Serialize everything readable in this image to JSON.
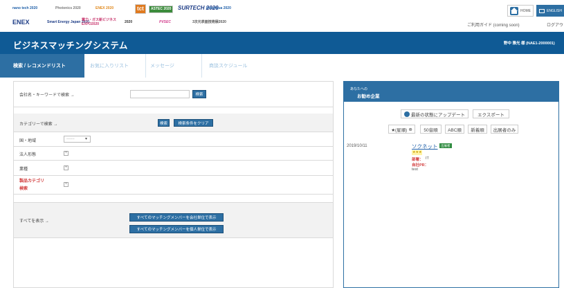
{
  "banner": {
    "logos_row1": [
      "nano tech 2020",
      "Photonics 2020",
      "ENEX 2020",
      "tct",
      "ASTEC 2020",
      "SURTECH 2020",
      "InterAqua 2020"
    ],
    "logos_row2": [
      "ENEX",
      "Smart Energy Japan 2020",
      "電力・ガス新ビジネス EXPO2020",
      "2020",
      "PVSEC",
      "3次元表面技術展2020"
    ],
    "home_label": "HOME",
    "english_label": "ENGLISH",
    "usage_guide": "ご利用ガイド (coming soon)",
    "logout": "ログアウト"
  },
  "header": {
    "title": "ビジネスマッチングシステム",
    "user": "野中 雅光 様 (NAE1-2000001)"
  },
  "tabs": [
    {
      "label": "検索 / レコメンドリスト",
      "active": true
    },
    {
      "label": "お気に入りリスト",
      "active": false
    },
    {
      "label": "メッセージ",
      "active": false
    },
    {
      "label": "商談スケジュール",
      "active": false
    }
  ],
  "search": {
    "keyword_label": "会社名・キーワードで検索 →",
    "keyword_value": "",
    "search_button": "検索",
    "category_label": "カテゴリーで検索 →",
    "category_search_button": "検索",
    "clear_button": "検索条件をクリア",
    "country_label": "国・地域",
    "country_select": "-------",
    "corporate_label": "法人形態",
    "industry_label": "業種",
    "product_label_line1": "製品カテゴリ",
    "product_label_line2": "検索",
    "show_all_label": "すべてを表示 →",
    "show_all_company_button": "すべてのマッチングメンバーを会社単位で表示",
    "show_all_person_button": "すべてのマッチングメンバーを個人単位で表示"
  },
  "recommend": {
    "head_small": "あなたへの",
    "head_big": "お勧め企業",
    "update_button": "最新の状態にアップデート",
    "export_button": "エクスポート",
    "sort_buttons": [
      "★(星順)",
      "50音順",
      "ABC順",
      "新着順",
      "出展者のみ"
    ],
    "sort_indicator": "⊕",
    "entry": {
      "date": "2019/10/11",
      "company": "ソクネット",
      "badge": "出展者",
      "stars": "★★★",
      "dept_label": "部署：",
      "dept_value": "IT",
      "pr_label": "自社PR：",
      "pr_value": "test"
    }
  }
}
